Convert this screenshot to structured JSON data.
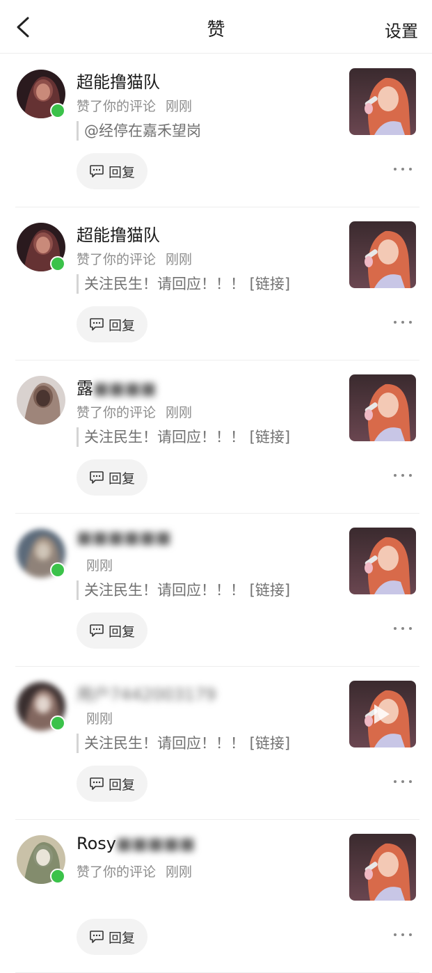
{
  "header": {
    "title": "赞",
    "settings_label": "设置"
  },
  "reply_label": "回复",
  "notifications": [
    {
      "username": "超能撸猫队",
      "username_blurred": "",
      "action": "赞了你的评论",
      "time": "刚刚",
      "quote": "@经停在嘉禾望岗",
      "online": true,
      "avatar_blurred": false,
      "thumb_has_play": false
    },
    {
      "username": "超能撸猫队",
      "username_blurred": "",
      "action": "赞了你的评论",
      "time": "刚刚",
      "quote": "关注民生！请回应！！！ [链接]",
      "online": true,
      "avatar_blurred": false,
      "thumb_has_play": false
    },
    {
      "username": "露",
      "username_blurred": "■■■■",
      "action": "赞了你的评论",
      "time": "刚刚",
      "quote": "关注民生！请回应！！！ [链接]",
      "online": false,
      "avatar_blurred": false,
      "thumb_has_play": false
    },
    {
      "username": "",
      "username_blurred": "■■■■■■",
      "action": "",
      "time": "刚刚",
      "quote": "关注民生！请回应！！！ [链接]",
      "online": true,
      "avatar_blurred": true,
      "thumb_has_play": false
    },
    {
      "username": "",
      "username_blurred": "用户7442003179",
      "action": "",
      "time": "刚刚",
      "quote": "关注民生！请回应！！！ [链接]",
      "online": true,
      "avatar_blurred": true,
      "thumb_has_play": true
    },
    {
      "username": "Rosy",
      "username_blurred": "■■■■■",
      "action": "赞了你的评论",
      "time": "刚刚",
      "quote": "",
      "online": true,
      "avatar_blurred": false,
      "thumb_has_play": false
    }
  ]
}
